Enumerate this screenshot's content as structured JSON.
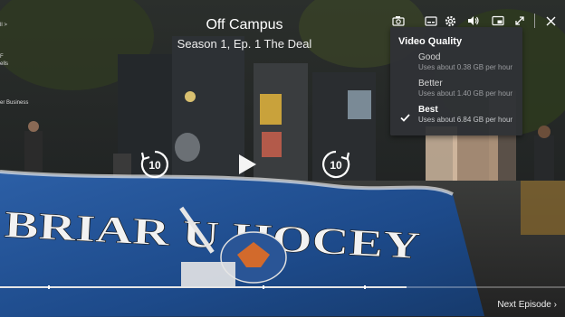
{
  "player": {
    "title": "Off Campus",
    "episode": "Season 1, Ep. 1 The Deal",
    "progress": 0.72,
    "chapter_markers": [
      0.085,
      0.465,
      0.645
    ]
  },
  "toolbar": {
    "icons": [
      "camera-icon",
      "subtitles-icon",
      "settings-icon",
      "volume-icon",
      "picture-in-picture-icon",
      "fullscreen-icon",
      "close-icon"
    ]
  },
  "quality_menu": {
    "heading": "Video Quality",
    "options": [
      {
        "name": "Good",
        "desc": "Uses about 0.38 GB per hour",
        "selected": false
      },
      {
        "name": "Better",
        "desc": "Uses about 1.40 GB per hour",
        "selected": false
      },
      {
        "name": "Best",
        "desc": "Uses about 6.84 GB per hour",
        "selected": true
      }
    ]
  },
  "controls": {
    "rewind_seconds": "10",
    "forward_seconds": "10"
  },
  "next_episode": {
    "label": "Next Episode"
  },
  "left_panel": {
    "lines": [
      "ll >",
      "F",
      "ells",
      "er Business"
    ]
  },
  "banner": {
    "text": "BRIAR U HOCEY"
  },
  "colors": {
    "banner_blue": "#1f4d8f",
    "menu_bg": "#303236",
    "accent": "#ffffff"
  }
}
